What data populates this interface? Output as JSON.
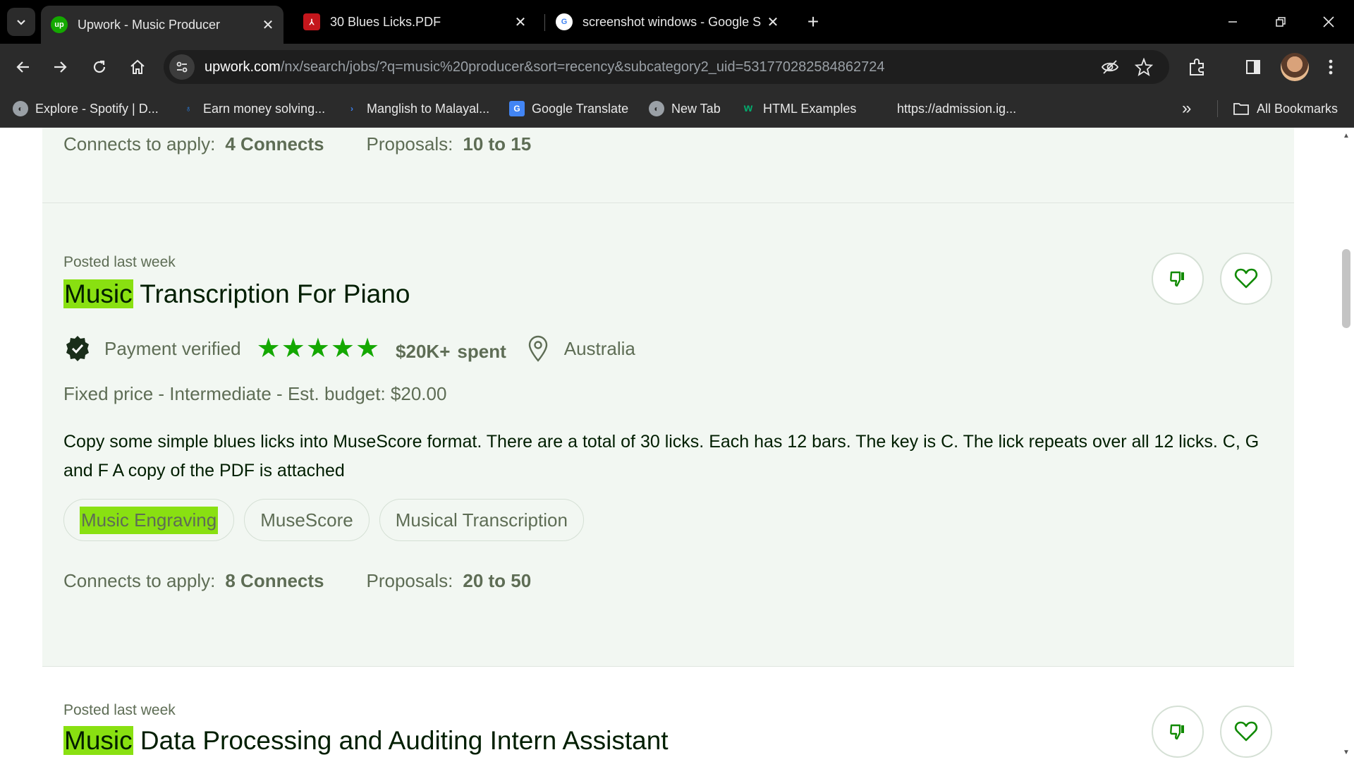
{
  "tabs": [
    {
      "title": "Upwork - Music Producer",
      "active": true
    },
    {
      "title": "30 Blues Licks.PDF",
      "active": false
    },
    {
      "title": "screenshot windows - Google S",
      "active": false
    }
  ],
  "address": {
    "host": "upwork.com",
    "path": "/nx/search/jobs/?q=music%20producer&sort=recency&subcategory2_uid=531770282584862724"
  },
  "bookmarks": [
    {
      "label": "Explore - Spotify | D..."
    },
    {
      "label": "Earn money solving..."
    },
    {
      "label": "Manglish to Malayal..."
    },
    {
      "label": "Google Translate"
    },
    {
      "label": "New Tab"
    },
    {
      "label": "HTML Examples"
    },
    {
      "label": "https://admission.ig..."
    }
  ],
  "all_bookmarks_label": "All Bookmarks",
  "job_prev": {
    "connects_label": "Connects to apply:",
    "connects_value": "4 Connects",
    "proposals_label": "Proposals:",
    "proposals_value": "10 to 15"
  },
  "job_main": {
    "posted": "Posted last week",
    "title_highlight": "Music",
    "title_rest": " Transcription For Piano",
    "payment": "Payment verified",
    "rating_stars": 5,
    "spent_amount": "$20K+",
    "spent_label": "spent",
    "location": "Australia",
    "price_type": "Fixed price",
    "level": "Intermediate",
    "budget": "Est. budget: $20.00",
    "description": "Copy some simple blues licks into MuseScore format. There are a total of 30 licks. Each has 12 bars. The key is C. The lick repeats over all 12 licks. C, G and F A copy of the PDF is attached",
    "skills": [
      "Music Engraving",
      "MuseScore",
      "Musical Transcription"
    ],
    "connects_label": "Connects to apply:",
    "connects_value": "8 Connects",
    "proposals_label": "Proposals:",
    "proposals_value": "20 to 50"
  },
  "job_next": {
    "posted": "Posted last week",
    "title_highlight": "Music",
    "title_rest": " Data Processing and Auditing Intern Assistant"
  },
  "colors": {
    "accent_green": "#14a800",
    "highlight": "#89e011",
    "card_bg": "#f2f7f2"
  }
}
